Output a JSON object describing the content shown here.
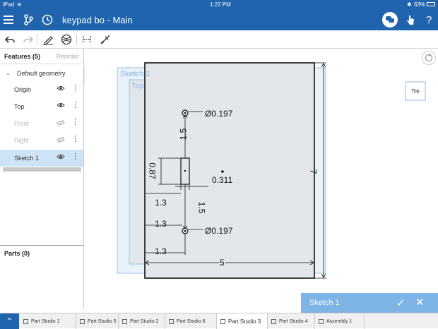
{
  "statusbar": {
    "device": "iPad",
    "time": "1:22 PM",
    "battery": "63%"
  },
  "app": {
    "document_title": "keypad bo - Main"
  },
  "feature_panel": {
    "title": "Features (5)",
    "reorder_label": "Reorder",
    "group_label": "Default geometry",
    "items": [
      {
        "label": "Origin",
        "hidden": false
      },
      {
        "label": "Top",
        "hidden": false
      },
      {
        "label": "Front",
        "hidden": true
      },
      {
        "label": "Right",
        "hidden": true
      },
      {
        "label": "Sketch 1",
        "hidden": false,
        "selected": true
      }
    ],
    "parts_title": "Parts (0)"
  },
  "canvas": {
    "sketch_plane_label": "Sketch 1",
    "plane_label": "Top",
    "viewcube_label": "Top",
    "dimensions": {
      "hole_top": "Ø0.197",
      "hole_bottom": "Ø0.197",
      "vert_top": "1.5",
      "vert_bottom": "1.5",
      "slot_height": "0.87",
      "slot_width": "0.311",
      "left_a": "1.3",
      "left_b": "1.3",
      "left_c": "1.3",
      "width": "5",
      "height": "7"
    }
  },
  "sketch_bar": {
    "title": "Sketch 1"
  },
  "tabs": [
    {
      "label": "Part Studio 1",
      "active": false
    },
    {
      "label": "Part Studio 5",
      "active": false
    },
    {
      "label": "Part Studio 2",
      "active": false
    },
    {
      "label": "Part Studio 6",
      "active": false
    },
    {
      "label": "Part Studio 3",
      "active": true
    },
    {
      "label": "Part Studio 4",
      "active": false
    },
    {
      "label": "Assembly 1",
      "active": false
    }
  ],
  "colors": {
    "brand": "#1f64ad",
    "selection": "#cfe3f6",
    "sketch_plane": "#9cc3e6"
  }
}
